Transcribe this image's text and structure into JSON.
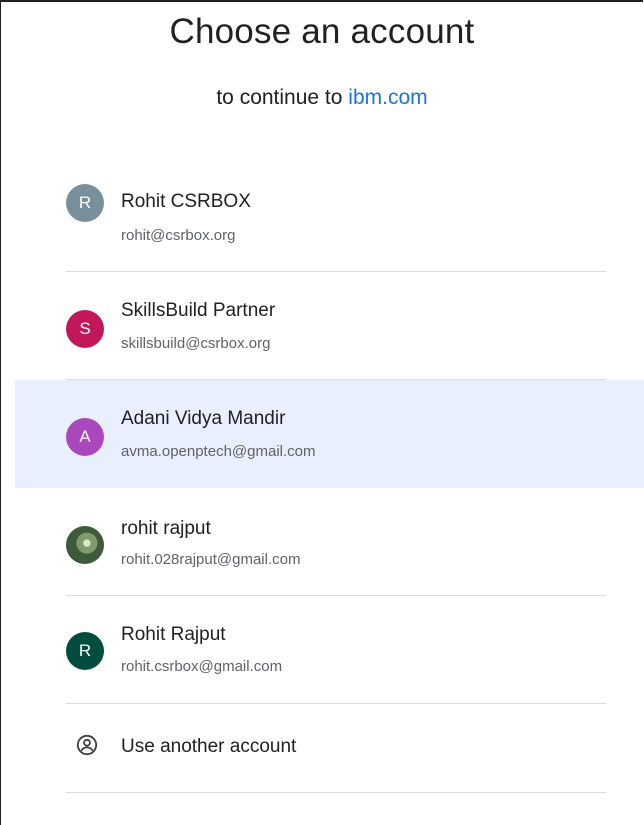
{
  "header": {
    "title": "Choose an account",
    "subtitle_prefix": "to continue to",
    "subtitle_link": "ibm.com"
  },
  "accounts": [
    {
      "initial": "R",
      "name": "Rohit CSRBOX",
      "email": "rohit@csrbox.org",
      "avatar_color": "#78909c",
      "selected": false
    },
    {
      "initial": "S",
      "name": "SkillsBuild Partner",
      "email": "skillsbuild@csrbox.org",
      "avatar_color": "#c2185b",
      "selected": false
    },
    {
      "initial": "A",
      "name": "Adani Vidya Mandir",
      "email": "avma.openptech@gmail.com",
      "avatar_color": "#ab47bc",
      "selected": true
    },
    {
      "initial": "",
      "name": "rohit rajput",
      "email": "rohit.028rajput@gmail.com",
      "avatar_color": "#3d5a3a",
      "selected": false
    },
    {
      "initial": "R",
      "name": "Rohit Rajput",
      "email": "rohit.csrbox@gmail.com",
      "avatar_color": "#004d40",
      "selected": false
    }
  ],
  "another_account": {
    "label": "Use another account",
    "icon": "account-circle-icon"
  },
  "colors": {
    "link": "#1a73e8",
    "selected_row": "#e8f0fe",
    "divider": "#dadce0"
  }
}
